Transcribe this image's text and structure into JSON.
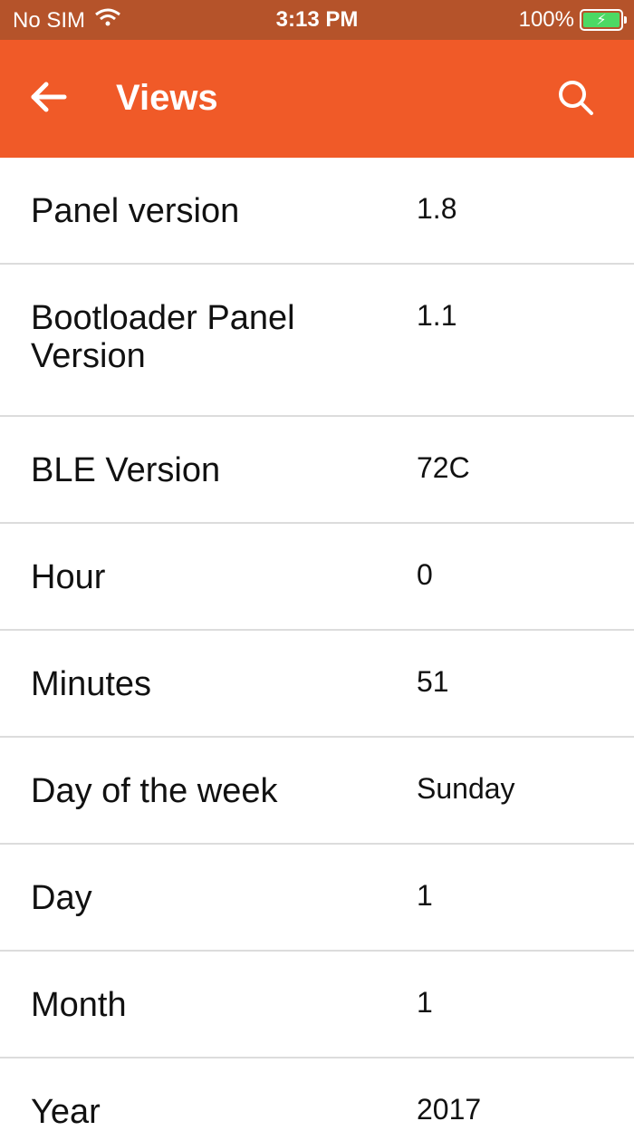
{
  "status_bar": {
    "carrier": "No SIM",
    "time": "3:13 PM",
    "battery": "100%"
  },
  "app_bar": {
    "title": "Views",
    "back_icon": "back-arrow-icon",
    "search_icon": "search-icon",
    "color": "#f05a28"
  },
  "rows": [
    {
      "label": "Panel version",
      "value": "1.8"
    },
    {
      "label": "Bootloader Panel Version",
      "value": "1.1"
    },
    {
      "label": "BLE Version",
      "value": "72C"
    },
    {
      "label": "Hour",
      "value": "0"
    },
    {
      "label": "Minutes",
      "value": "51"
    },
    {
      "label": "Day of the week",
      "value": "Sunday"
    },
    {
      "label": "Day",
      "value": "1"
    },
    {
      "label": "Month",
      "value": "1"
    },
    {
      "label": "Year",
      "value": "2017"
    }
  ]
}
